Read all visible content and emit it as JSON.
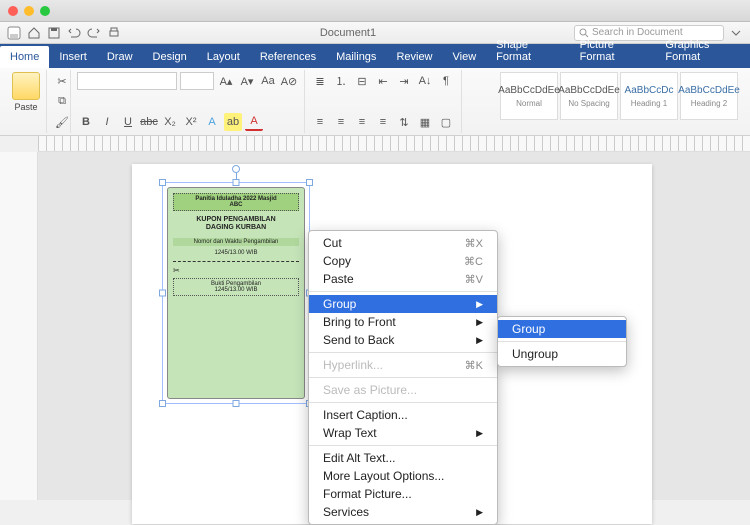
{
  "window": {
    "doc_title": "Document1",
    "search_placeholder": "Search in Document"
  },
  "tabs": [
    "Home",
    "Insert",
    "Draw",
    "Design",
    "Layout",
    "References",
    "Mailings",
    "Review",
    "View",
    "Shape Format",
    "Picture Format",
    "Graphics Format"
  ],
  "ribbon": {
    "paste": "Paste",
    "font_name": "",
    "font_size": "",
    "styles": [
      {
        "preview": "AaBbCcDdEe",
        "name": "Normal"
      },
      {
        "preview": "AaBbCcDdEe",
        "name": "No Spacing"
      },
      {
        "preview": "AaBbCcDc",
        "name": "Heading 1"
      },
      {
        "preview": "AaBbCcDdEe",
        "name": "Heading 2"
      }
    ]
  },
  "coupon": {
    "header_line1": "Panitia Iduladha 2022 Masjid",
    "header_line2": "ABC",
    "title_line1": "KUPON PENGAMBILAN",
    "title_line2": "DAGING KURBAN",
    "subheader": "Nomor dan Waktu Pengambilan",
    "value1": "1245/13.00 WIB",
    "receipt": "Bukti Pengambilan",
    "value2": "1245/13.00 WIB"
  },
  "context_menu": {
    "items": [
      {
        "label": "Cut",
        "shortcut": "⌘X"
      },
      {
        "label": "Copy",
        "shortcut": "⌘C"
      },
      {
        "label": "Paste",
        "shortcut": "⌘V"
      },
      {
        "sep": true
      },
      {
        "label": "Group",
        "submenu": true,
        "highlight": true
      },
      {
        "label": "Bring to Front",
        "submenu": true
      },
      {
        "label": "Send to Back",
        "submenu": true
      },
      {
        "sep": true
      },
      {
        "label": "Hyperlink...",
        "shortcut": "⌘K",
        "disabled": true
      },
      {
        "sep": true
      },
      {
        "label": "Save as Picture...",
        "disabled": true
      },
      {
        "sep": true
      },
      {
        "label": "Insert Caption..."
      },
      {
        "label": "Wrap Text",
        "submenu": true
      },
      {
        "sep": true
      },
      {
        "label": "Edit Alt Text..."
      },
      {
        "label": "More Layout Options..."
      },
      {
        "label": "Format Picture..."
      },
      {
        "label": "Services",
        "submenu": true
      }
    ],
    "submenu_items": [
      {
        "label": "Group",
        "highlight": true
      },
      {
        "label": "Ungroup"
      }
    ]
  }
}
